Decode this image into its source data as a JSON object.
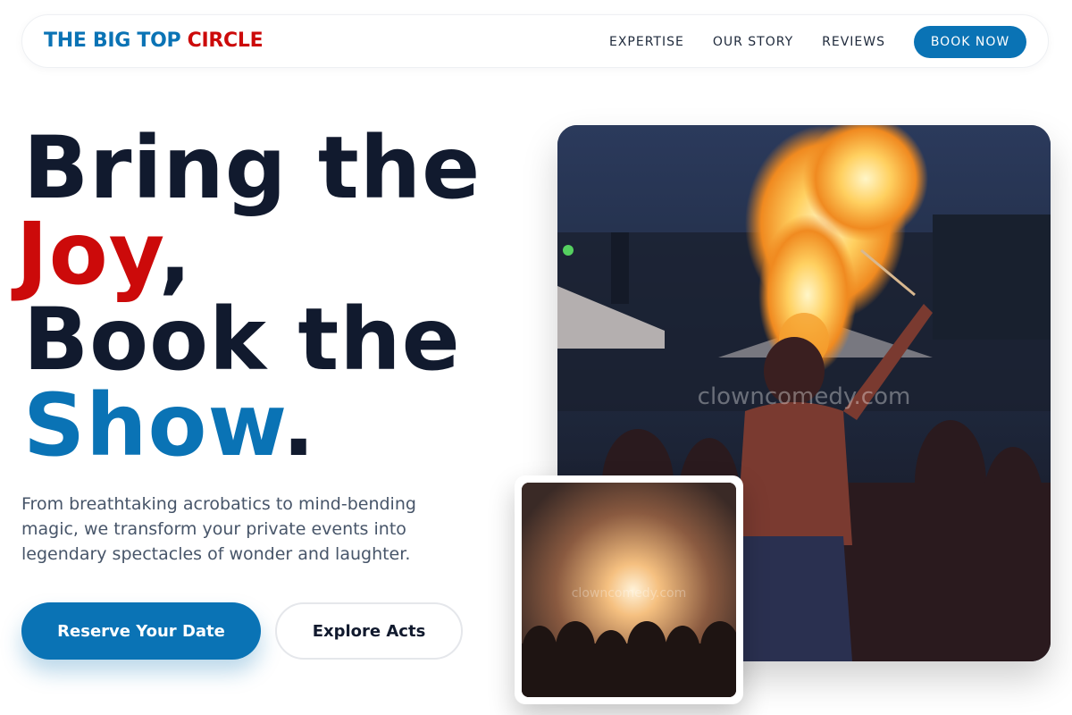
{
  "nav": {
    "logo_blue": "THE BIG TOP ",
    "logo_red": "CIRCLE",
    "links": [
      "EXPERTISE",
      "OUR STORY",
      "REVIEWS"
    ],
    "cta": "BOOK NOW"
  },
  "hero": {
    "line1": "Bring the",
    "joy": "Joy",
    "comma": ",",
    "line3": "Book the",
    "show": "Show",
    "period": ".",
    "subtext": "From breathtaking acrobatics to mind-bending magic, we transform your private events into legendary spectacles of wonder and laughter.",
    "primary_button": "Reserve Your Date",
    "secondary_button": "Explore Acts"
  },
  "images": {
    "main_watermark": "clowncomedy.com",
    "inset_watermark": "clowncomedy.com"
  },
  "colors": {
    "brand_blue": "#0a73b5",
    "brand_red": "#cc0a0a",
    "heading_dark": "#111a2e"
  }
}
